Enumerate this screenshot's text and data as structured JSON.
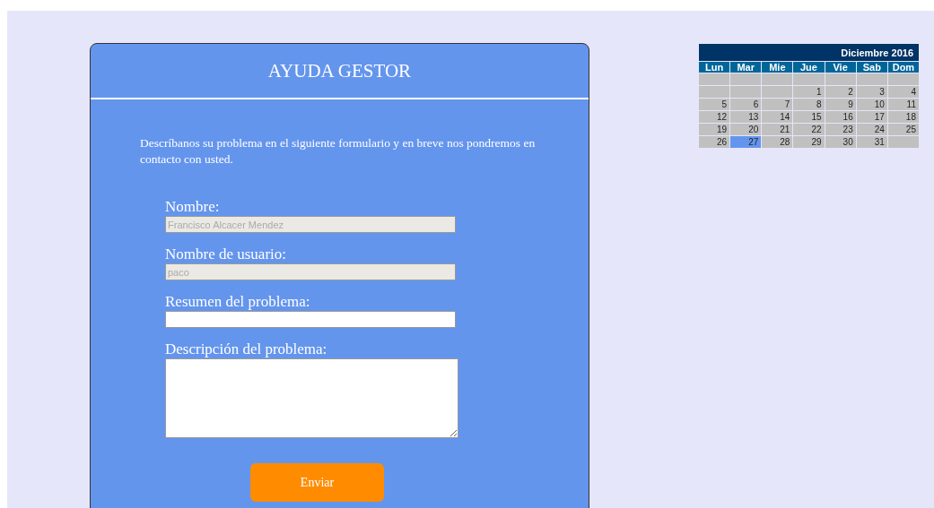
{
  "card": {
    "title": "AYUDA GESTOR",
    "intro": "Descríbanos su problema en el siguiente formulario y en breve nos pondremos en contacto con usted.",
    "fields": [
      {
        "kind": "input",
        "label": "Nombre:",
        "value": "Francisco Alcacer Mendez",
        "disabled": true
      },
      {
        "kind": "input",
        "label": "Nombre de usuario:",
        "value": "paco",
        "disabled": true
      },
      {
        "kind": "input",
        "label": "Resumen del problema:",
        "disabled": false
      },
      {
        "kind": "textarea",
        "label": "Descripción del problema:",
        "disabled": false
      }
    ],
    "submit": "Enviar"
  },
  "calendar": {
    "title": "Diciembre 2016",
    "weekdays": [
      "Lun",
      "Mar",
      "Mie",
      "Jue",
      "Vie",
      "Sab",
      "Dom"
    ],
    "weeks": [
      [
        {
          "kind": "blank"
        },
        {
          "kind": "blank"
        },
        {
          "kind": "blank"
        },
        {
          "kind": "blank"
        },
        {
          "kind": "blank"
        },
        {
          "kind": "blank"
        },
        {
          "kind": "blank"
        }
      ],
      [
        {
          "kind": "blank"
        },
        {
          "kind": "blank"
        },
        {
          "kind": "blank"
        },
        {
          "kind": "day",
          "day": "1",
          "selected": false
        },
        {
          "kind": "day",
          "day": "2",
          "selected": false
        },
        {
          "kind": "day",
          "day": "3",
          "selected": false
        },
        {
          "kind": "day",
          "day": "4",
          "selected": false
        }
      ],
      [
        {
          "kind": "day",
          "day": "5",
          "selected": false
        },
        {
          "kind": "day",
          "day": "6",
          "selected": false
        },
        {
          "kind": "day",
          "day": "7",
          "selected": false
        },
        {
          "kind": "day",
          "day": "8",
          "selected": false
        },
        {
          "kind": "day",
          "day": "9",
          "selected": false
        },
        {
          "kind": "day",
          "day": "10",
          "selected": false
        },
        {
          "kind": "day",
          "day": "11",
          "selected": false
        }
      ],
      [
        {
          "kind": "day",
          "day": "12",
          "selected": false
        },
        {
          "kind": "day",
          "day": "13",
          "selected": false
        },
        {
          "kind": "day",
          "day": "14",
          "selected": false
        },
        {
          "kind": "day",
          "day": "15",
          "selected": false
        },
        {
          "kind": "day",
          "day": "16",
          "selected": false
        },
        {
          "kind": "day",
          "day": "17",
          "selected": false
        },
        {
          "kind": "day",
          "day": "18",
          "selected": false
        }
      ],
      [
        {
          "kind": "day",
          "day": "19",
          "selected": false
        },
        {
          "kind": "day",
          "day": "20",
          "selected": false
        },
        {
          "kind": "day",
          "day": "21",
          "selected": false
        },
        {
          "kind": "day",
          "day": "22",
          "selected": false
        },
        {
          "kind": "day",
          "day": "23",
          "selected": false
        },
        {
          "kind": "day",
          "day": "24",
          "selected": false
        },
        {
          "kind": "day",
          "day": "25",
          "selected": false
        }
      ],
      [
        {
          "kind": "day",
          "day": "26",
          "selected": false
        },
        {
          "kind": "day",
          "day": "27",
          "selected": true
        },
        {
          "kind": "day",
          "day": "28",
          "selected": false
        },
        {
          "kind": "day",
          "day": "29",
          "selected": false
        },
        {
          "kind": "day",
          "day": "30",
          "selected": false
        },
        {
          "kind": "day",
          "day": "31",
          "selected": false
        },
        {
          "kind": "blank"
        }
      ]
    ]
  }
}
